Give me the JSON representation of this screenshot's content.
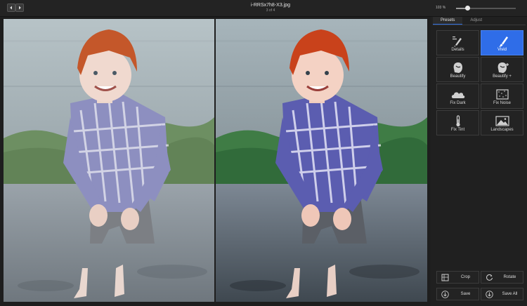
{
  "header": {
    "filename": "i-RRSx7h8-X3.jpg",
    "position": "3 of 4",
    "zoom": "103 %",
    "zoom_fraction": 0.19
  },
  "icons": {
    "prev": "chevron-left-icon",
    "next": "chevron-right-icon"
  },
  "tabs": [
    {
      "label": "Presets",
      "active": true
    },
    {
      "label": "Adjust",
      "active": false
    }
  ],
  "presets": [
    {
      "label": "Details",
      "icon": "sliders-brush-icon",
      "active": false
    },
    {
      "label": "Vivid",
      "icon": "brush-icon",
      "active": true
    },
    {
      "label": "Beautify",
      "icon": "face-icon",
      "active": false
    },
    {
      "label": "Beautify +",
      "icon": "face-plus-icon",
      "active": false
    },
    {
      "label": "Fix Dark",
      "icon": "cloud-icon",
      "active": false
    },
    {
      "label": "Fix Noise",
      "icon": "noise-icon",
      "active": false
    },
    {
      "label": "Fix Tint",
      "icon": "thermometer-icon",
      "active": false
    },
    {
      "label": "Landscapes",
      "icon": "mountain-picture-icon",
      "active": false
    }
  ],
  "actions": [
    {
      "label": "Crop",
      "icon": "crop-icon"
    },
    {
      "label": "Rotate",
      "icon": "rotate-icon"
    },
    {
      "label": "Save",
      "icon": "save-icon"
    },
    {
      "label": "Save All",
      "icon": "save-all-icon"
    }
  ],
  "colors": {
    "accent": "#2f6de8",
    "background": "#1e1e1e"
  }
}
